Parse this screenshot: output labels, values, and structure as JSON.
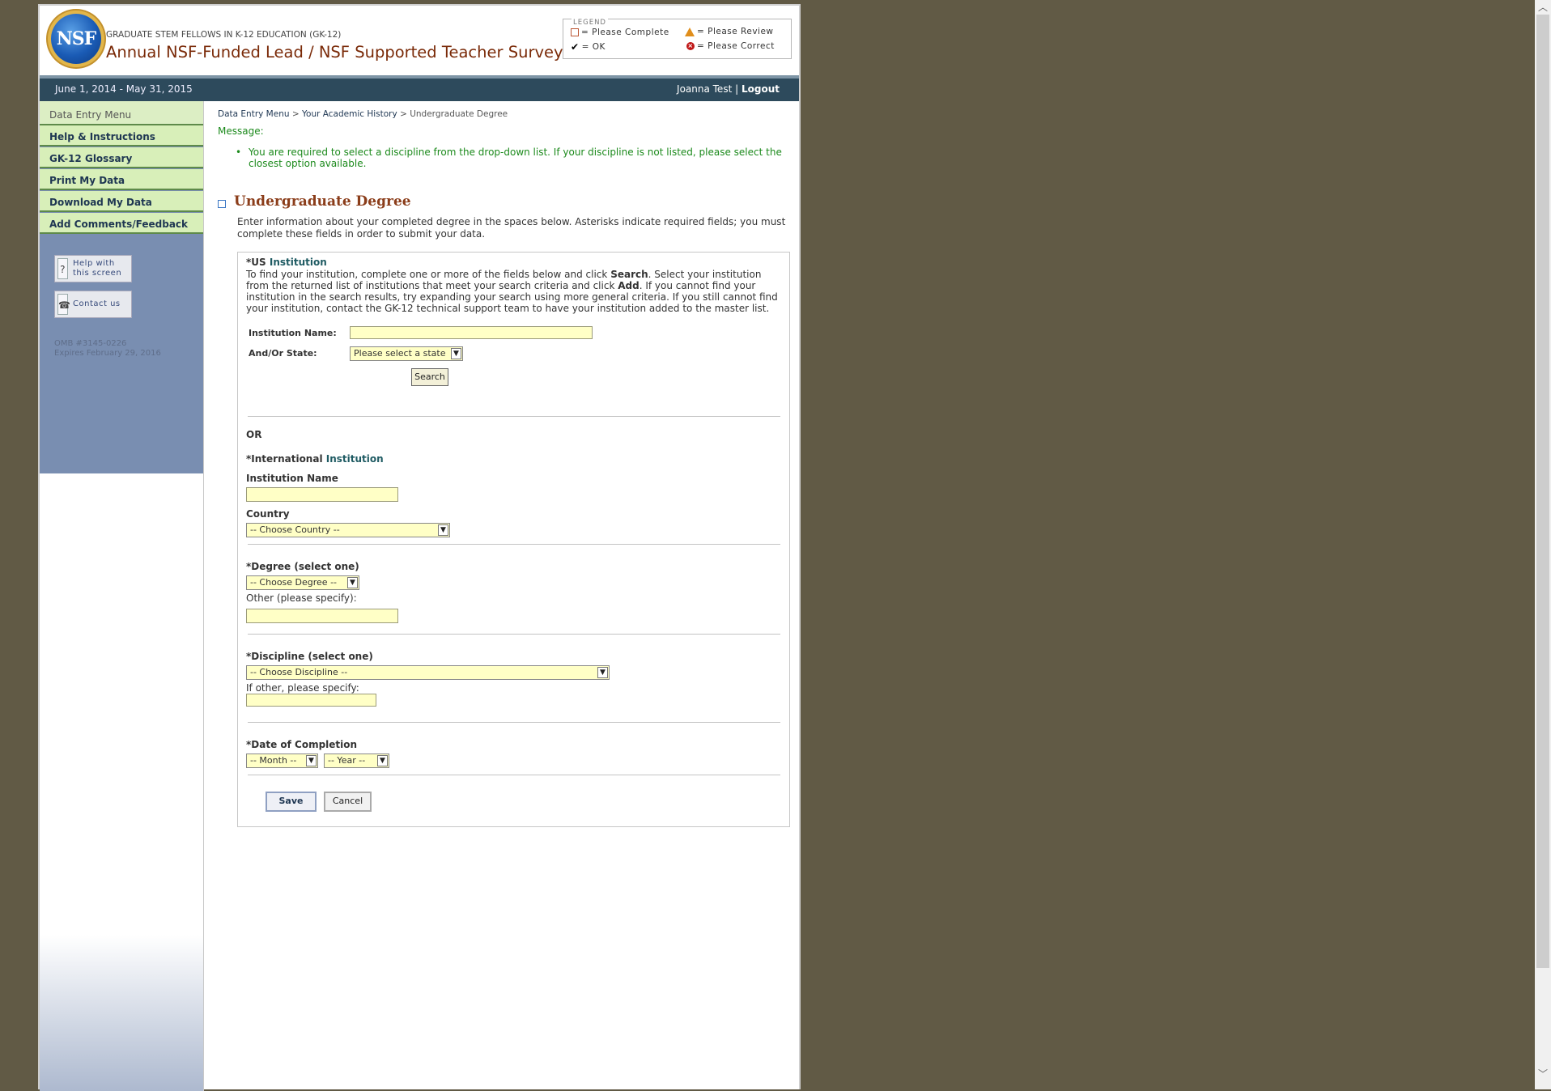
{
  "header": {
    "logo_text": "NSF",
    "subtitle": "GRADUATE STEM FELLOWS IN K-12 EDUCATION (GK-12)",
    "title": "Annual NSF-Funded Lead / NSF Supported Teacher Survey"
  },
  "legend": {
    "title": "LEGEND",
    "please_complete": "= Please Complete",
    "please_review": "= Please Review",
    "ok": "= OK",
    "please_correct": "= Please Correct"
  },
  "topbar": {
    "dates": "June 1, 2014 - May 31, 2015",
    "user": "Joanna Test",
    "separator": "|",
    "logout": "Logout"
  },
  "sidebar": {
    "header": "Data Entry Menu",
    "items": [
      {
        "label": "Help & Instructions"
      },
      {
        "label": "GK-12 Glossary"
      },
      {
        "label": "Print My Data"
      },
      {
        "label": "Download My Data"
      },
      {
        "label": "Add Comments/Feedback"
      }
    ],
    "help_line1": "Help with",
    "help_line2": "this screen",
    "contact": "Contact us",
    "omb_line1": "OMB #3145-0226",
    "omb_line2": "Expires February 29, 2016"
  },
  "breadcrumb": {
    "item1": "Data Entry Menu",
    "item2": "Your Academic History",
    "current": "Undergraduate Degree",
    "sep": ">"
  },
  "message": {
    "label": "Message:",
    "text": "You are required to select a discipline from the drop-down list. If your discipline is not listed, please select the closest option available."
  },
  "section": {
    "title": "Undergraduate Degree",
    "intro": "Enter information about your completed degree in the spaces below. Asterisks indicate required fields; you must complete these fields in order to submit your data."
  },
  "us_institution": {
    "label_prefix": "*US",
    "label_suffix": "Institution",
    "instructions_1": "To find your institution, complete one or more of the fields below and click",
    "search_word": "Search",
    "instructions_2": ". Select your institution from the returned list of institutions that meet your search criteria and click",
    "add_word": "Add",
    "instructions_3": ". If you cannot find your institution in the search results, try expanding your search using more general criteria. If you still cannot find your institution, contact the GK-12 technical support team to have your institution added to the master list.",
    "name_label": "Institution Name:",
    "name_value": "",
    "state_label": "And/Or State:",
    "state_value": "Please select a state",
    "search_button": "Search"
  },
  "or_label": "OR",
  "intl_institution": {
    "label_prefix": "*International",
    "label_suffix": "Institution",
    "name_label": "Institution Name",
    "name_value": "",
    "country_label": "Country",
    "country_value": "-- Choose Country --"
  },
  "degree": {
    "label": "*Degree (select one)",
    "value": "-- Choose Degree --",
    "other_label": "Other (please specify):",
    "other_value": ""
  },
  "discipline": {
    "label": "*Discipline (select one)",
    "value": "-- Choose Discipline --",
    "other_label": "If other, please specify:",
    "other_value": ""
  },
  "completion": {
    "label": "*Date of Completion",
    "month_value": "-- Month --",
    "year_value": "-- Year --"
  },
  "actions": {
    "save": "Save",
    "cancel": "Cancel"
  },
  "colors": {
    "background": "#615a45",
    "topbar": "#2d4a5c",
    "menu_bg": "#d8efb9",
    "input_bg": "#ffffc6",
    "title_brown": "#8b3d1a",
    "message_green": "#1c8a1c"
  }
}
